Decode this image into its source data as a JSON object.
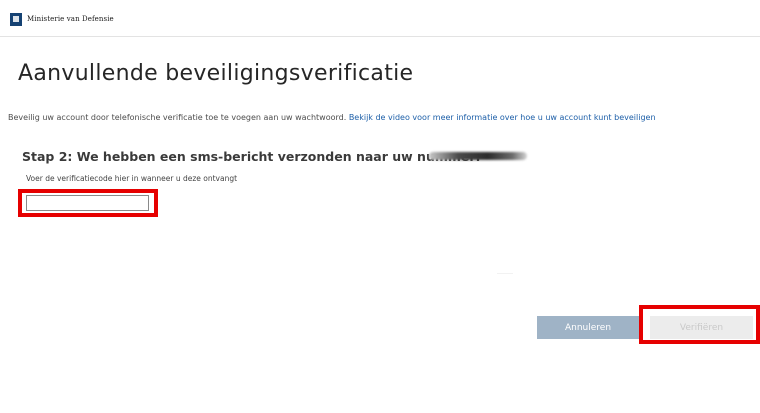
{
  "header": {
    "org_name": "Ministerie van Defensie",
    "logo_icon": "dutch-coat-of-arms-icon",
    "logo_color": "#154273"
  },
  "main": {
    "title": "Aanvullende beveiligingsverificatie",
    "intro_text": "Beveilig uw account door telefonische verificatie toe te voegen aan uw wachtwoord.",
    "intro_link": "Bekijk de video voor meer informatie over hoe u uw account kunt beveiligen",
    "step_heading": "Stap 2: We hebben een sms-bericht verzonden naar uw nummer:",
    "code_label": "Voer de verificatiecode hier in wanneer u deze ontvangt",
    "code_value": ""
  },
  "buttons": {
    "cancel_label": "Annuleren",
    "verify_label": "Verifiëren"
  },
  "colors": {
    "highlight": "#e60000",
    "link": "#1d5fa8",
    "cancel_button": "#9fb3c6",
    "verify_button_disabled": "#ececec"
  }
}
